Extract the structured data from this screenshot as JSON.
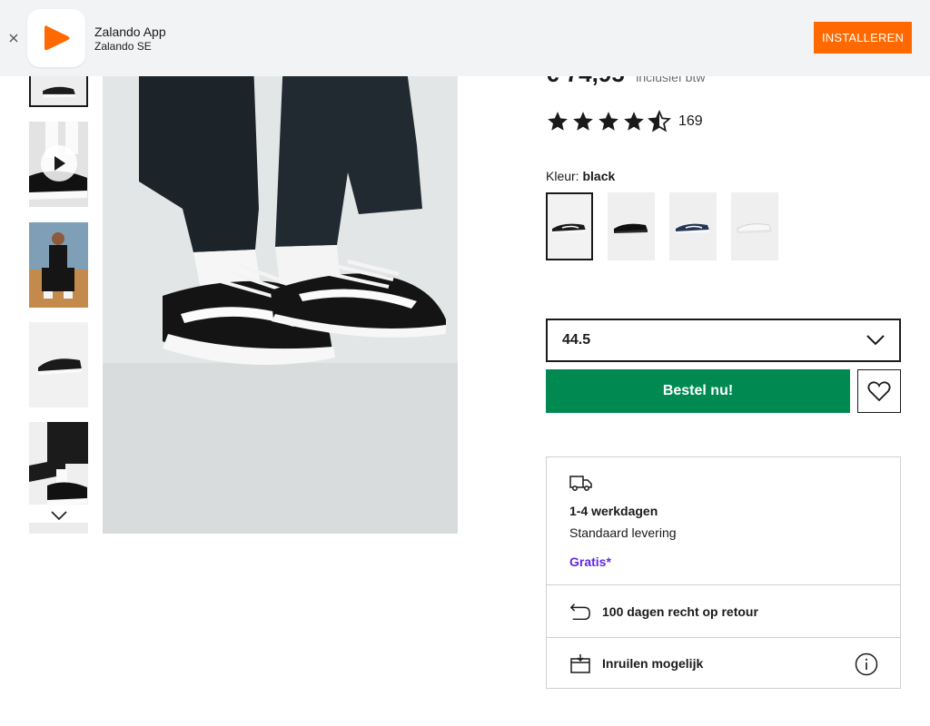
{
  "banner": {
    "app_name": "Zalando App",
    "publisher": "Zalando SE",
    "install_label": "INSTALLEREN",
    "brand_color": "#ff6900"
  },
  "product": {
    "price": "€ 74,95",
    "price_note": "inclusief btw",
    "rating_value": 4.5,
    "rating_max": 5,
    "review_count": "169",
    "color_label": "Kleur:",
    "color_value": "black",
    "swatches": [
      {
        "name": "black",
        "selected": true
      },
      {
        "name": "black-all",
        "selected": false
      },
      {
        "name": "navy",
        "selected": false
      },
      {
        "name": "white",
        "selected": false
      }
    ],
    "size": "44.5",
    "buy_label": "Bestel nu!",
    "buy_color": "#008a52"
  },
  "delivery": {
    "days": "1-4 werkdagen",
    "type": "Standaard levering",
    "price": "Gratis*",
    "price_color": "#6328e0",
    "returns": "100 dagen recht op retour",
    "exchange": "Inruilen mogelijk"
  },
  "gallery": {
    "thumb_count": 6,
    "selected_index": 0
  }
}
